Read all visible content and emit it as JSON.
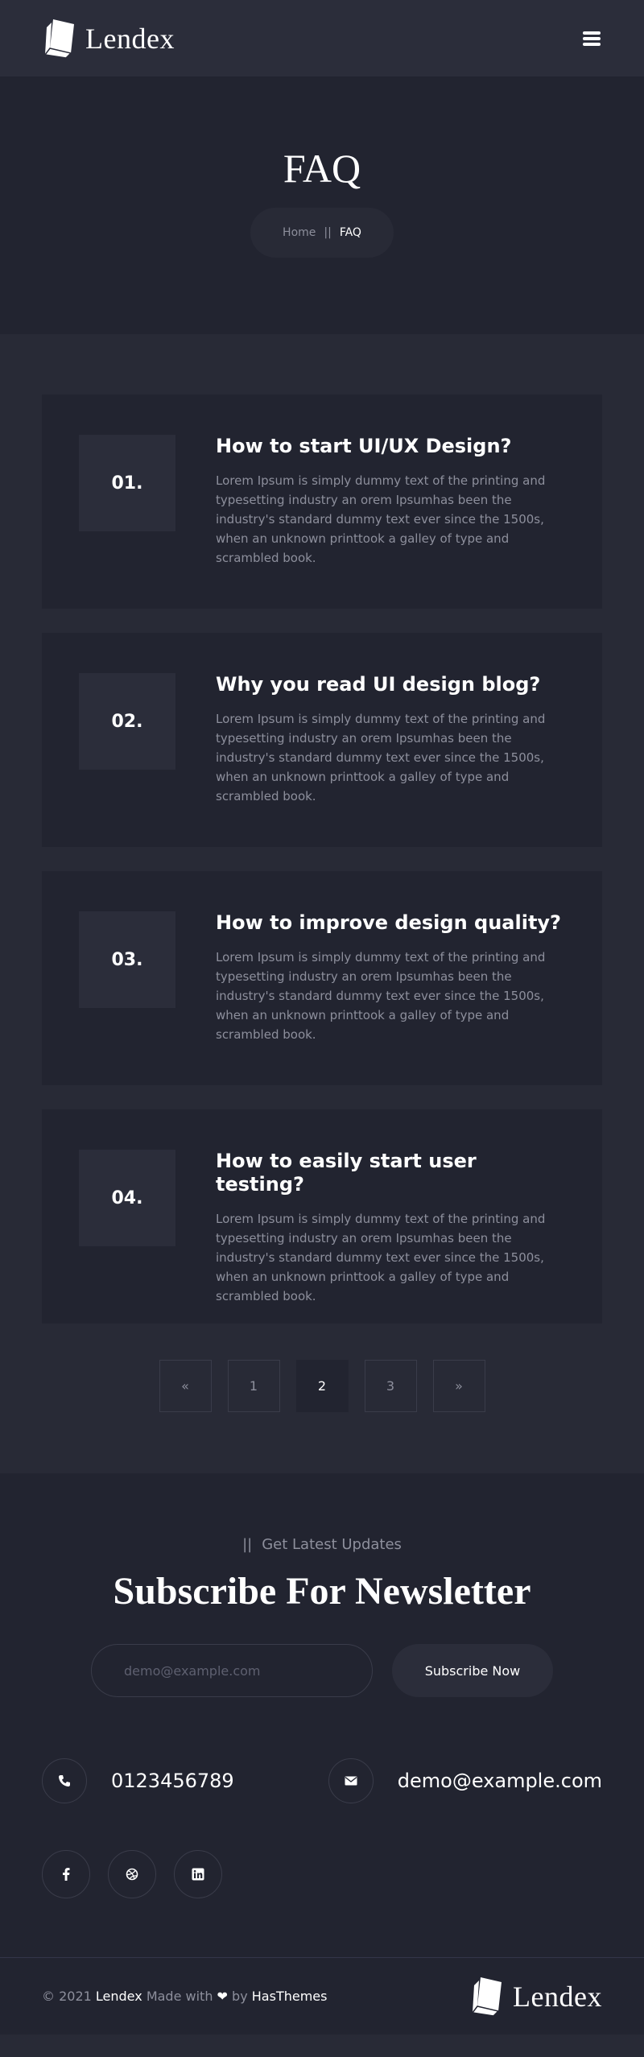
{
  "header": {
    "brand": "Lendex",
    "logo_icon": "book-icon",
    "menu_icon": "hamburger-icon"
  },
  "hero": {
    "title": "FAQ",
    "breadcrumb": {
      "home": "Home",
      "separator": "||",
      "current": "FAQ"
    }
  },
  "faqs": [
    {
      "number": "01.",
      "question": "How to start UI/UX Design?",
      "answer": "Lorem Ipsum is simply dummy text of the printing and typesetting industry an orem Ipsumhas been the industry's standard dummy text ever since the 1500s, when an unknown printtook a galley of type and scrambled book."
    },
    {
      "number": "02.",
      "question": "Why you read UI design blog?",
      "answer": "Lorem Ipsum is simply dummy text of the printing and typesetting industry an orem Ipsumhas been the industry's standard dummy text ever since the 1500s, when an unknown printtook a galley of type and scrambled book."
    },
    {
      "number": "03.",
      "question": "How to improve design quality?",
      "answer": "Lorem Ipsum is simply dummy text of the printing and typesetting industry an orem Ipsumhas been the industry's standard dummy text ever since the 1500s, when an unknown printtook a galley of type and scrambled book."
    },
    {
      "number": "04.",
      "question": "How to easily start user testing?",
      "answer": "Lorem Ipsum is simply dummy text of the printing and typesetting industry an orem Ipsumhas been the industry's standard dummy text ever since the 1500s, when an unknown printtook a galley of type and scrambled book."
    }
  ],
  "pagination": {
    "prev": "«",
    "pages": [
      "1",
      "2",
      "3"
    ],
    "active": "2",
    "next": "»"
  },
  "newsletter": {
    "eyebrow_bars": "||",
    "eyebrow": "Get Latest Updates",
    "title": "Subscribe For Newsletter",
    "input_placeholder": "demo@example.com",
    "button": "Subscribe Now"
  },
  "contact": {
    "phone": "0123456789",
    "phone_icon": "phone-icon",
    "email": "demo@example.com",
    "email_icon": "envelope-icon"
  },
  "social": [
    {
      "name": "facebook-icon",
      "glyph": "f"
    },
    {
      "name": "dribbble-icon",
      "glyph": ""
    },
    {
      "name": "linkedin-icon",
      "glyph": "in"
    }
  ],
  "footer": {
    "copy_prefix": "© 2021",
    "brand": "Lendex",
    "made_with": "Made with",
    "heart": "❤",
    "by": "by",
    "author": "HasThemes"
  },
  "colors": {
    "page_bg": "#282a36",
    "dark_bg": "#222430",
    "muted_text": "#8d8f9c",
    "text": "#ffffff"
  }
}
